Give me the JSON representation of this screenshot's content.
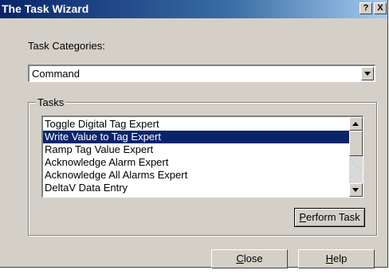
{
  "window": {
    "title": "The Task Wizard",
    "help_glyph": "?",
    "close_glyph": "X"
  },
  "task_categories": {
    "label": "Task Categories:",
    "selected": "Command"
  },
  "tasks": {
    "label": "Tasks",
    "items": [
      {
        "label": "Toggle Digital Tag Expert",
        "selected": false
      },
      {
        "label": "Write Value to Tag Expert",
        "selected": true
      },
      {
        "label": "Ramp Tag Value Expert",
        "selected": false
      },
      {
        "label": "Acknowledge Alarm Expert",
        "selected": false
      },
      {
        "label": "Acknowledge All Alarms Expert",
        "selected": false
      },
      {
        "label": "DeltaV Data Entry",
        "selected": false
      }
    ]
  },
  "buttons": {
    "perform_task": {
      "mnemonic": "P",
      "rest": "erform Task"
    },
    "close": {
      "mnemonic": "C",
      "rest": "lose"
    },
    "help": {
      "mnemonic": "H",
      "rest": "elp"
    }
  },
  "colors": {
    "titlebar_start": "#0a246a",
    "titlebar_end": "#a6caf0",
    "selection": "#0a246a",
    "face": "#d4d0c8"
  }
}
